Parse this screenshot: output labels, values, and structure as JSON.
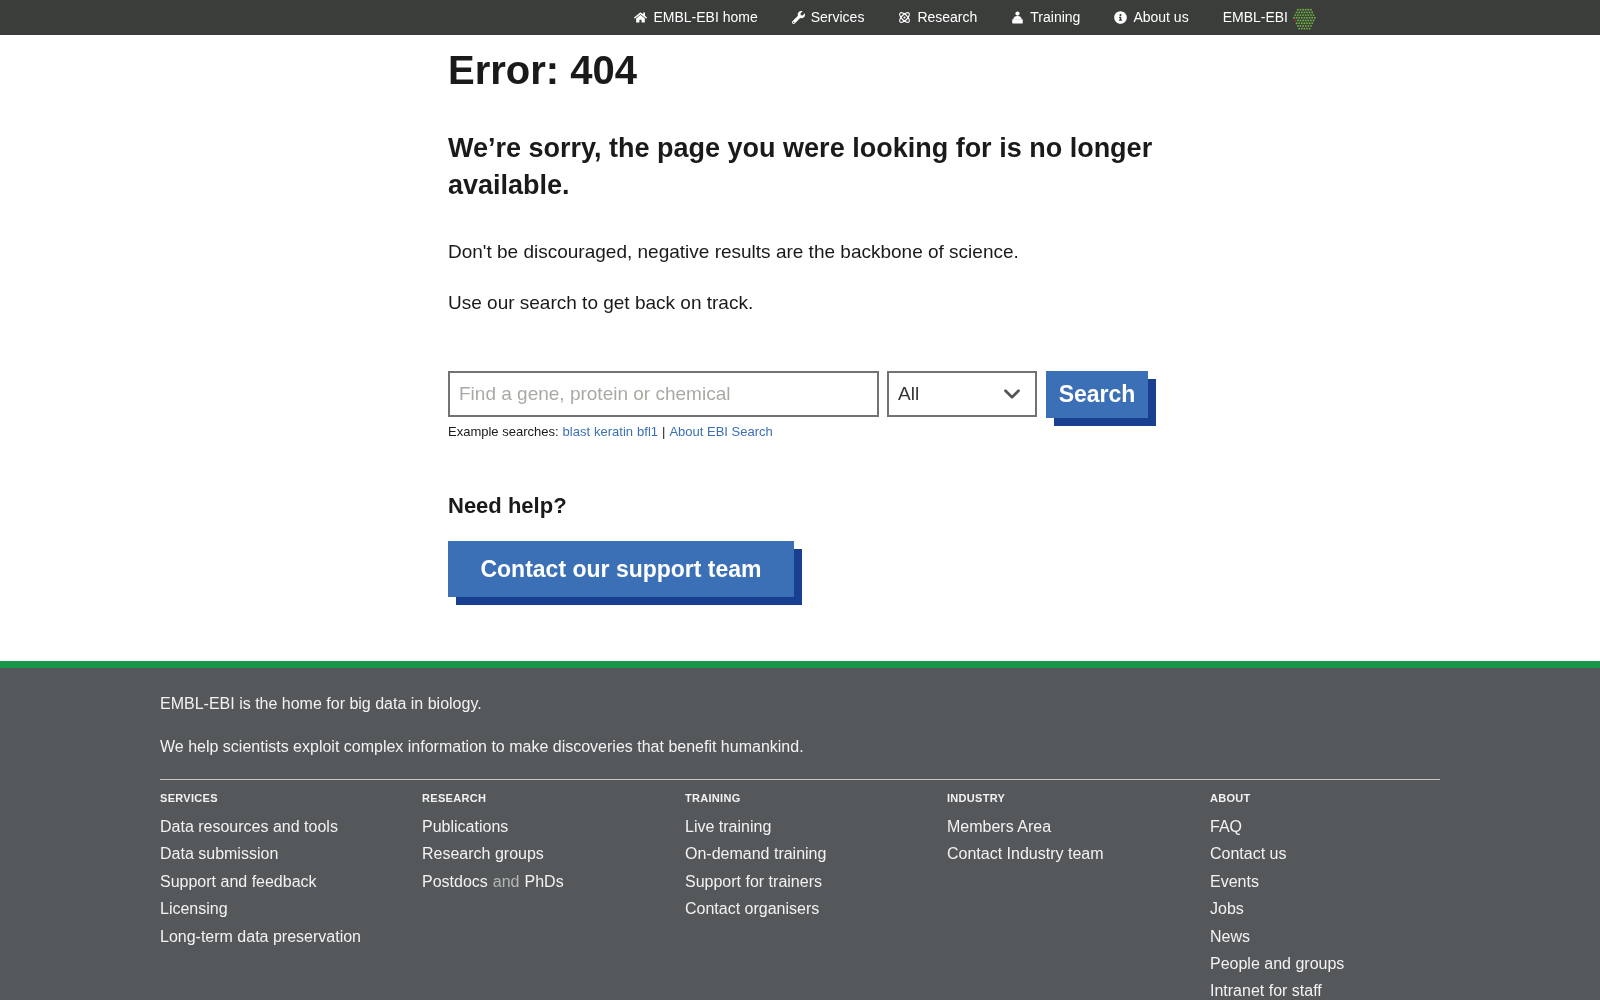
{
  "top_nav": {
    "items": [
      {
        "label": "EMBL-EBI home"
      },
      {
        "label": "Services"
      },
      {
        "label": "Research"
      },
      {
        "label": "Training"
      },
      {
        "label": "About us"
      }
    ],
    "brand": "EMBL-EBI"
  },
  "main": {
    "title": "Error: 404",
    "message": "We’re sorry, the page you were looking for is no longer available.",
    "paragraphs": [
      "Don't be discouraged, negative results are the backbone of science.",
      "Use our search to get back on track."
    ],
    "search": {
      "placeholder": "Find a gene, protein or chemical",
      "scope": "All",
      "button": "Search",
      "examples_label": "Example searches:",
      "examples": [
        "blast",
        "keratin",
        "bfl1"
      ],
      "separator": "|",
      "about_link": "About EBI Search"
    },
    "help": {
      "title": "Need help?",
      "button": "Contact our support team"
    }
  },
  "footer": {
    "lines": [
      "EMBL-EBI is the home for big data in biology.",
      "We help scientists exploit complex information to make discoveries that benefit humankind."
    ],
    "columns": [
      {
        "heading": "SERVICES",
        "links": [
          "Data resources and tools",
          "Data submission",
          "Support and feedback",
          "Licensing",
          "Long-term data preservation"
        ]
      },
      {
        "heading": "RESEARCH",
        "links": [
          "Publications",
          "Research groups",
          {
            "parts": [
              {
                "kind": "link",
                "text": "Postdocs"
              },
              {
                "kind": "text",
                "text": "and"
              },
              {
                "kind": "link",
                "text": "PhDs"
              }
            ]
          }
        ]
      },
      {
        "heading": "TRAINING",
        "links": [
          "Live training",
          "On-demand training",
          "Support for trainers",
          "Contact organisers"
        ]
      },
      {
        "heading": "INDUSTRY",
        "links": [
          "Members Area",
          "Contact Industry team"
        ]
      },
      {
        "heading": "ABOUT",
        "links": [
          "FAQ",
          "Contact us",
          "Events",
          "Jobs",
          "News",
          "People and groups",
          "Intranet for staff"
        ]
      }
    ]
  }
}
